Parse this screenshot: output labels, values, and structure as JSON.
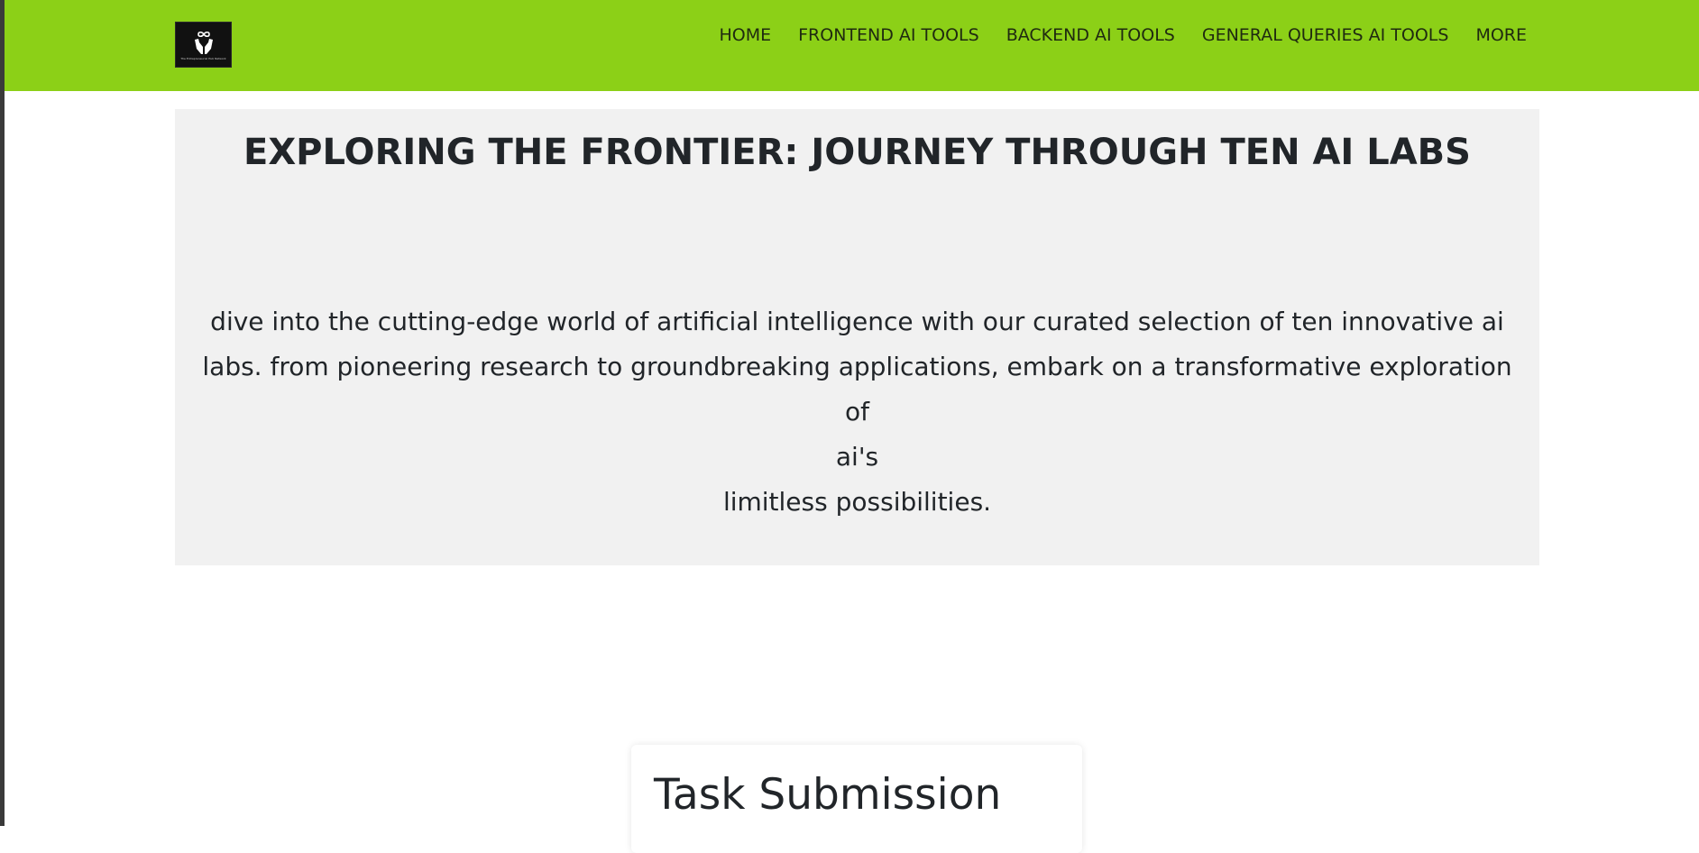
{
  "brand": {
    "logo_caption": "The Entrepreneurial Hub Network"
  },
  "nav": {
    "items": [
      {
        "label": "HOME"
      },
      {
        "label": "FRONTEND AI TOOLS"
      },
      {
        "label": "BACKEND AI TOOLS"
      },
      {
        "label": "GENERAL QUERIES AI TOOLS"
      },
      {
        "label": "MORE"
      }
    ]
  },
  "hero": {
    "title": "EXPLORING THE FRONTIER: JOURNEY THROUGH TEN AI LABS",
    "desc_line_1": "dive into the cutting-edge world of artificial intelligence with our curated selection of ten innovative ai",
    "desc_line_2": "labs. from pioneering research to groundbreaking applications, embark on a transformative exploration of",
    "desc_line_3": "ai's",
    "desc_line_4": "limitless possibilities."
  },
  "task": {
    "title": "Task Submission"
  },
  "colors": {
    "navbar_bg": "#8cd017",
    "hero_bg": "#f1f1f1",
    "text": "#212529"
  }
}
